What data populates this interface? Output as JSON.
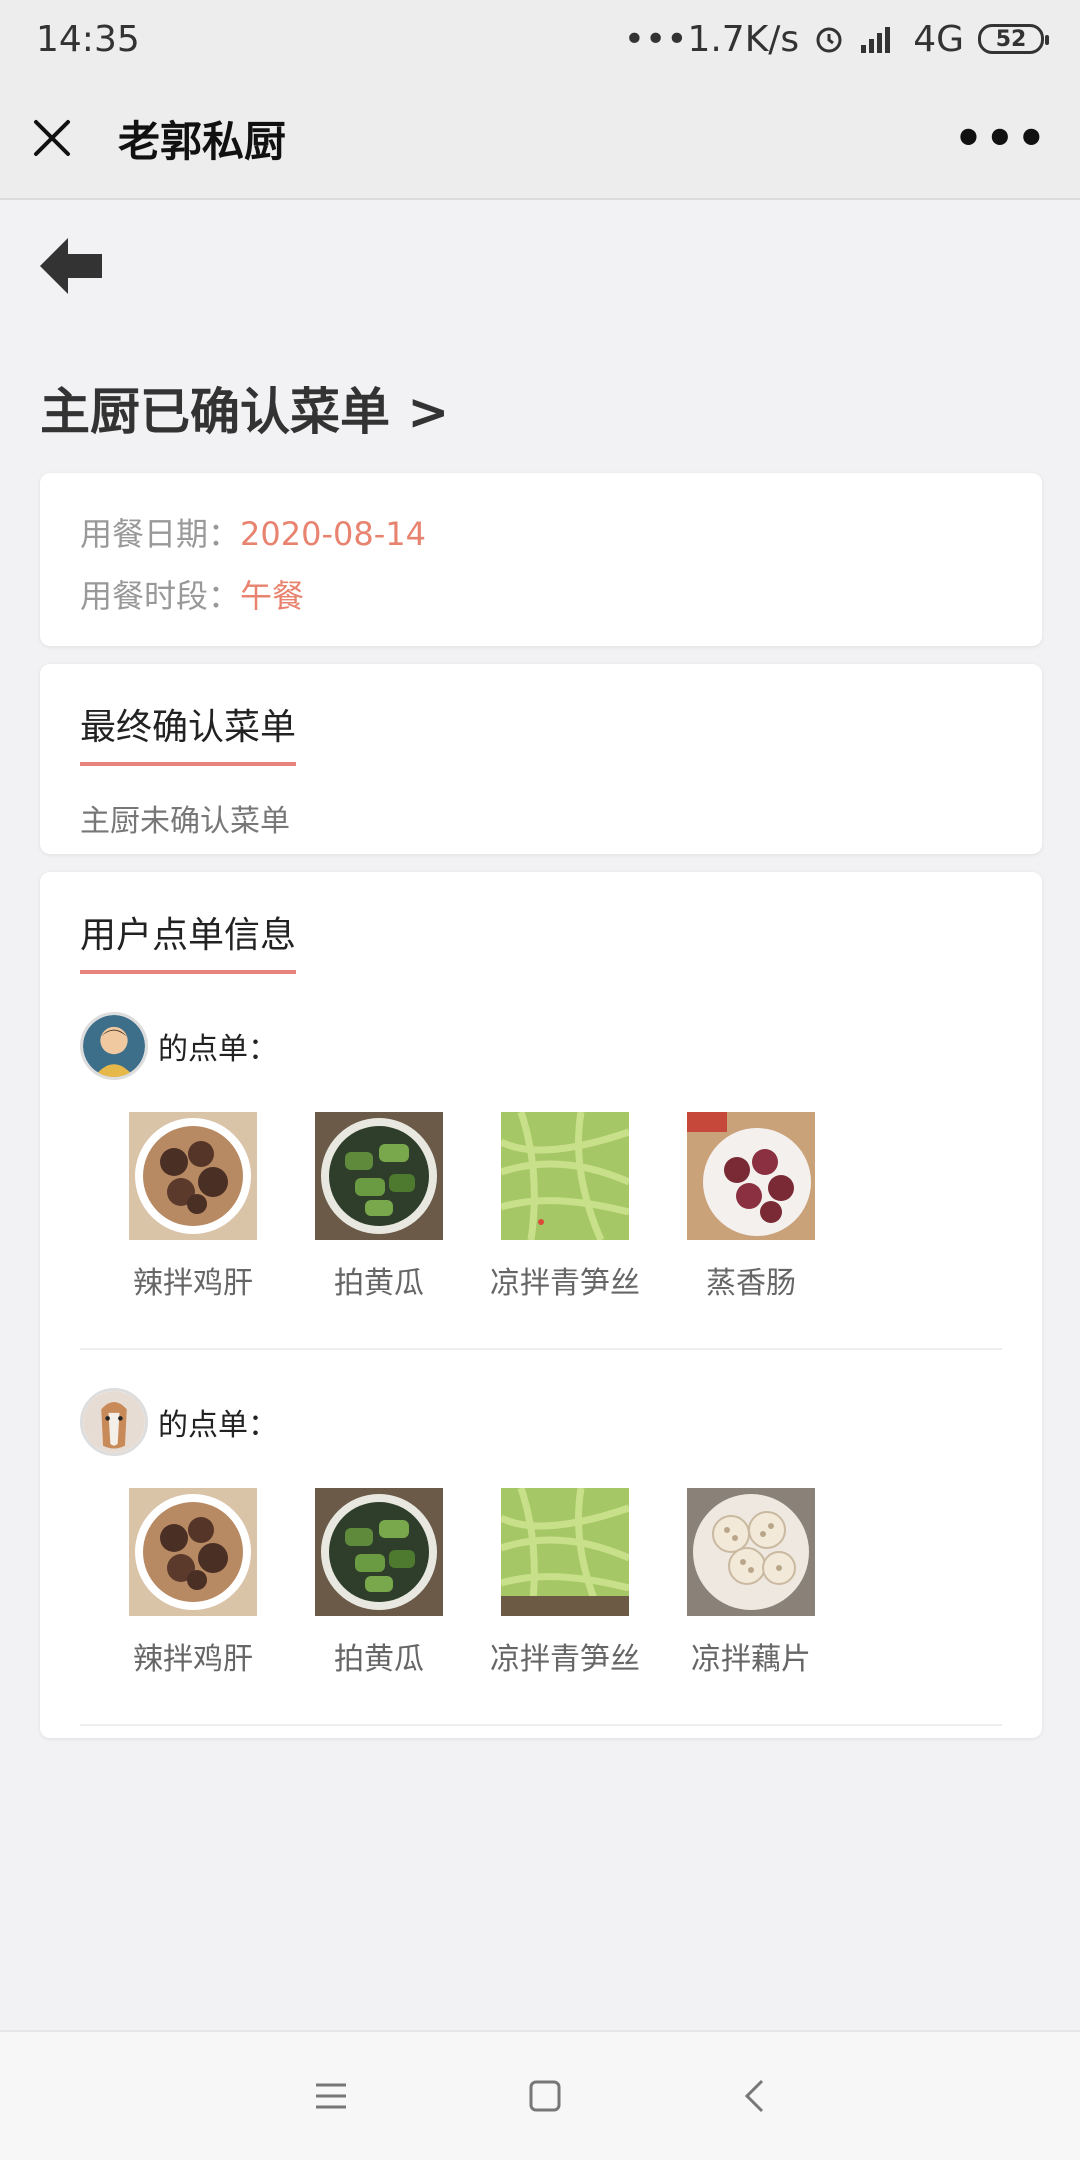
{
  "status": {
    "time": "14:35",
    "network_speed": "•••1.7K/s",
    "signal": "4G",
    "battery": "52"
  },
  "nav": {
    "title": "老郭私厨",
    "more": "•••"
  },
  "page": {
    "title": "主厨已确认菜单 >"
  },
  "meal": {
    "date_label": "用餐日期：",
    "date": "2020-08-14",
    "period_label": "用餐时段：",
    "period": "午餐"
  },
  "final_menu": {
    "heading": "最终确认菜单",
    "status": "主厨未确认菜单"
  },
  "user_orders": {
    "heading": "用户点单信息",
    "orders": [
      {
        "label": "的点单：",
        "dishes": [
          {
            "name": "辣拌鸡肝"
          },
          {
            "name": "拍黄瓜"
          },
          {
            "name": "凉拌青笋丝"
          },
          {
            "name": "蒸香肠"
          }
        ]
      },
      {
        "label": "的点单：",
        "dishes": [
          {
            "name": "辣拌鸡肝"
          },
          {
            "name": "拍黄瓜"
          },
          {
            "name": "凉拌青笋丝"
          },
          {
            "name": "凉拌藕片"
          }
        ]
      }
    ]
  },
  "colors": {
    "accent": "#e8836f",
    "underline": "#e8837d"
  }
}
